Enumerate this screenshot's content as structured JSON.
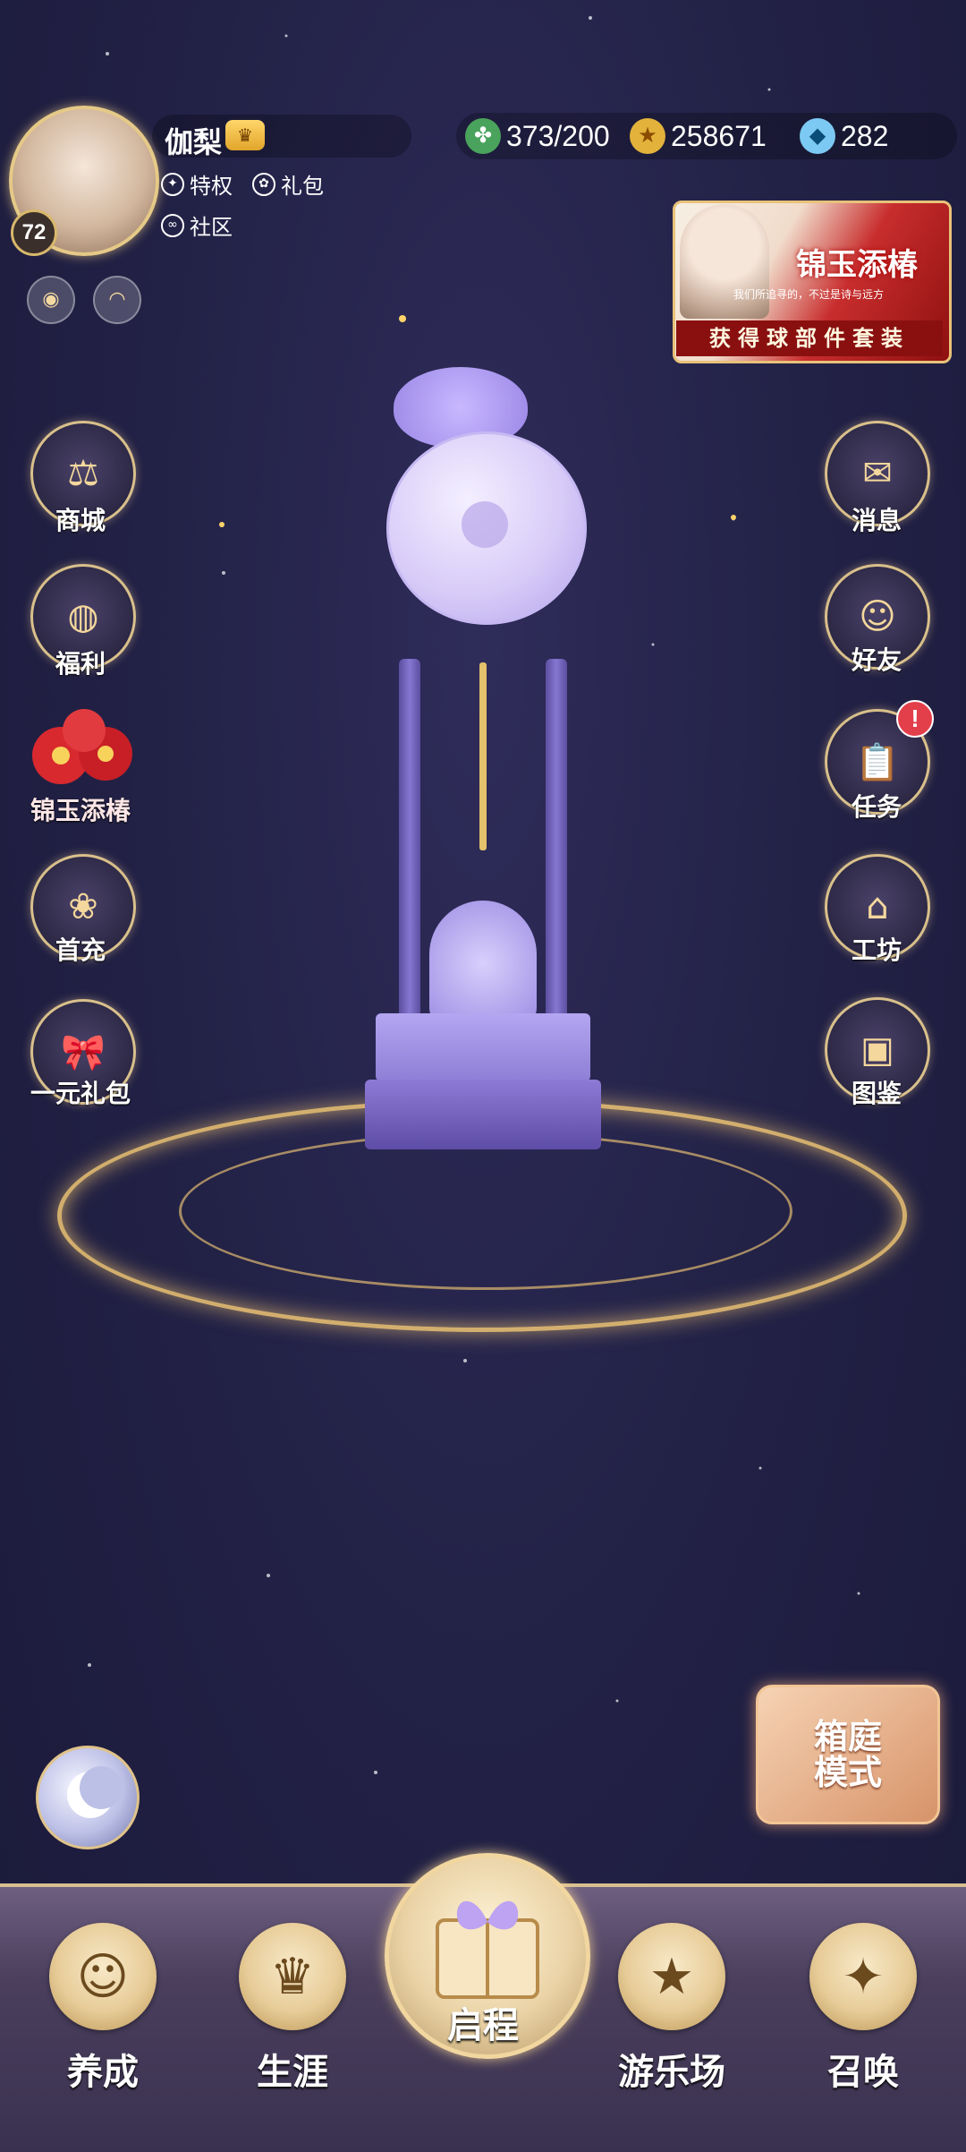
{
  "profile": {
    "name": "伽梨",
    "level": "72",
    "links": [
      "特权",
      "礼包",
      "社区"
    ]
  },
  "resources": {
    "stamina": "373/200",
    "gold": "258671",
    "diamond": "282"
  },
  "banner": {
    "title": "锦玉添椿",
    "subtitle": "我们所追寻的，不过是诗与远方",
    "bottom": "获得球部件套装"
  },
  "left_menu": [
    {
      "label": "商城"
    },
    {
      "label": "福利"
    },
    {
      "label": "锦玉添椿"
    },
    {
      "label": "首充"
    },
    {
      "label": "一元礼包"
    }
  ],
  "right_menu": [
    {
      "label": "消息"
    },
    {
      "label": "好友"
    },
    {
      "label": "任务",
      "badge": "!"
    },
    {
      "label": "工坊"
    },
    {
      "label": "图鉴"
    }
  ],
  "garden_mode": {
    "line1": "箱庭",
    "line2": "模式"
  },
  "bottom_nav": [
    "养成",
    "生涯",
    "启程",
    "游乐场",
    "召唤"
  ],
  "colors": {
    "accent_gold": "#e5c987",
    "alert_red": "#e33f4b",
    "bg_dark": "#1b1a3a"
  }
}
